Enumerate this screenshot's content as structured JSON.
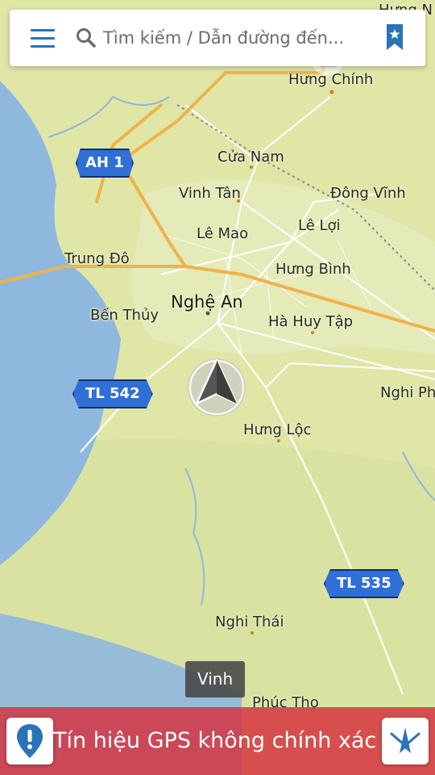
{
  "search": {
    "placeholder": "Tìm kiếm / Dẫn đường đến..."
  },
  "places": [
    {
      "name": "Hưng Chính",
      "big": false
    },
    {
      "name": "Cửa Nam",
      "big": false
    },
    {
      "name": "Vinh Tân",
      "big": false
    },
    {
      "name": "Đông Vĩnh",
      "big": false
    },
    {
      "name": "Lê Lợi",
      "big": false
    },
    {
      "name": "Lê Mao",
      "big": false
    },
    {
      "name": "Trung Đô",
      "big": false
    },
    {
      "name": "Hưng Bình",
      "big": false
    },
    {
      "name": "Nghệ An",
      "big": true
    },
    {
      "name": "Bến Thủy",
      "big": false
    },
    {
      "name": "Hà Huy Tập",
      "big": false
    },
    {
      "name": "Nghi Phú",
      "big": false
    },
    {
      "name": "Hưng Lộc",
      "big": false
    },
    {
      "name": "Nghi Thái",
      "big": false
    },
    {
      "name": "Phúc Thọ",
      "big": false
    },
    {
      "name": "Hưng N",
      "big": false
    }
  ],
  "shields": [
    {
      "label": "AH 1"
    },
    {
      "label": "TL 542"
    },
    {
      "label": "TL 535"
    }
  ],
  "toast": {
    "text": "Vinh"
  },
  "gps_warning": {
    "text": "Tín hiệu GPS không chính xác"
  },
  "colors": {
    "land": "#dfe6a6",
    "water": "#8fb8de",
    "major_road": "#f0b24a",
    "minor_road": "#ffffff",
    "shield_fill": "#2f6fd6",
    "accent_blue": "#2a73b8",
    "warning_red": "#d52e3c"
  }
}
